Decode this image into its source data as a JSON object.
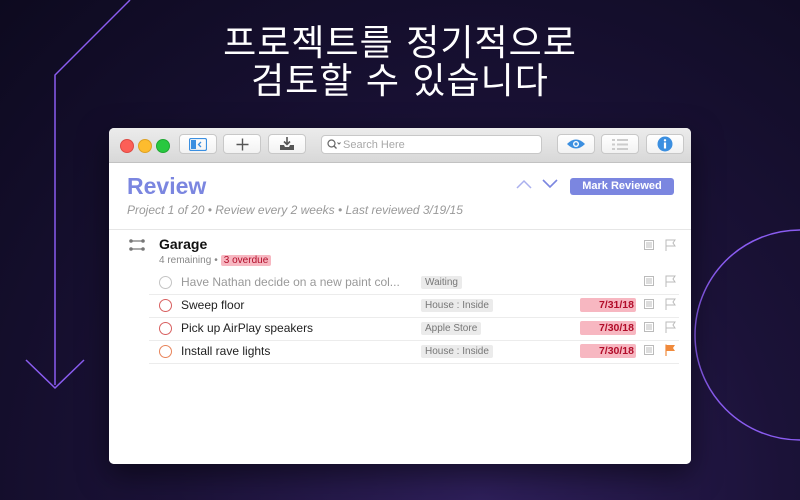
{
  "headline": {
    "line1": "프로젝트를 정기적으로",
    "line2": "검토할 수 있습니다"
  },
  "colors": {
    "accent": "#7b86e0",
    "overdue_bg": "#f7b7c1",
    "overdue_text": "#b20d2a",
    "flag_active": "#f08a3c",
    "background_line": "#8a5cf0"
  },
  "toolbar": {
    "buttons": [
      "sidebar-toggle-icon",
      "plus-icon",
      "inbox-download-icon",
      "eye-icon",
      "list-icon",
      "info-icon"
    ],
    "search_placeholder": "Search Here"
  },
  "review": {
    "title": "Review",
    "subtitle": "Project 1 of 20 • Review every 2 weeks • Last reviewed 3/19/15",
    "mark_reviewed_label": "Mark Reviewed"
  },
  "project": {
    "title": "Garage",
    "remaining": "4 remaining",
    "separator": "•",
    "overdue": "3 overdue"
  },
  "tasks": [
    {
      "name": "Have Nathan decide on a new paint col...",
      "tag": "Waiting",
      "due": "",
      "status": "dim",
      "flagged": false
    },
    {
      "name": "Sweep floor",
      "tag": "House : Inside",
      "due": "7/31/18",
      "status": "overdue",
      "flagged": false
    },
    {
      "name": "Pick up AirPlay speakers",
      "tag": "Apple Store",
      "due": "7/30/18",
      "status": "overdue",
      "flagged": false
    },
    {
      "name": "Install rave lights",
      "tag": "House : Inside",
      "due": "7/30/18",
      "status": "overdue-flagged",
      "flagged": true
    }
  ]
}
